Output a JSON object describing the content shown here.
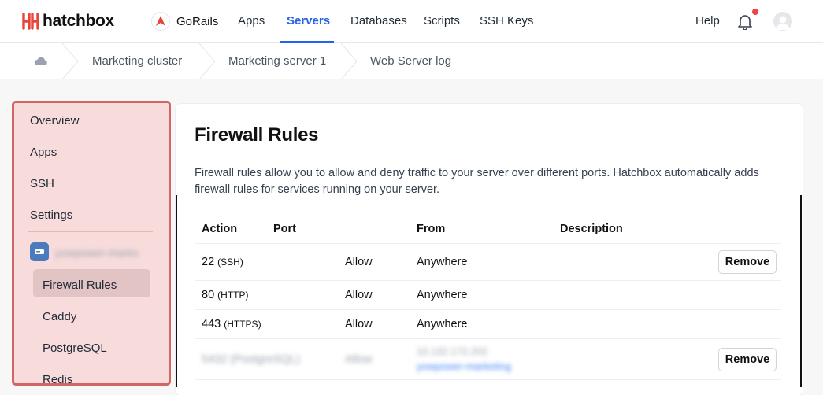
{
  "brand": {
    "name": "hatchbox",
    "color": "#e8443a"
  },
  "header": {
    "team": "GoRails",
    "nav": [
      "Apps",
      "Servers",
      "Databases",
      "Scripts",
      "SSH Keys"
    ],
    "active_nav": "Servers",
    "help": "Help",
    "accent": "#2563eb",
    "notification_dot_color": "#ef4444"
  },
  "breadcrumb": [
    "Marketing cluster",
    "Marketing server 1",
    "Web Server log"
  ],
  "sidebar": {
    "items": [
      "Overview",
      "Apps",
      "SSH",
      "Settings"
    ],
    "server_name": "yowpower-marks",
    "sub_items": [
      "Firewall Rules",
      "Caddy",
      "PostgreSQL",
      "Redis"
    ],
    "active_sub": "Firewall Rules",
    "highlight_border": "#d26565"
  },
  "main": {
    "title": "Firewall Rules",
    "description": "Firewall rules allow you to allow and deny traffic to your server over different ports. Hatchbox automatically adds firewall rules for services running on your server.",
    "columns": [
      "Action",
      "Port",
      "From",
      "Description"
    ],
    "rows": [
      {
        "port": "22",
        "proto": "(SSH)",
        "action": "Allow",
        "from": "Anywhere",
        "button": "Remove"
      },
      {
        "port": "80",
        "proto": "(HTTP)",
        "action": "Allow",
        "from": "Anywhere",
        "button": ""
      },
      {
        "port": "443",
        "proto": "(HTTPS)",
        "action": "Allow",
        "from": "Anywhere",
        "button": ""
      },
      {
        "port": "5432 (PostgreSQL)",
        "proto": "",
        "action": "Allow",
        "from": "10.132.172.202",
        "from_link": "yowpower-marketing",
        "button": "Remove"
      }
    ]
  }
}
